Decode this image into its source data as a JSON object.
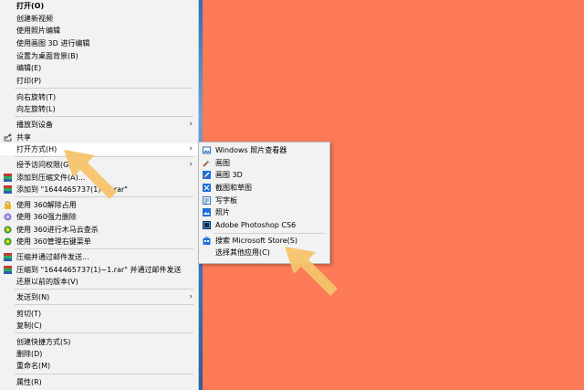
{
  "menu": {
    "items": [
      {
        "id": "open",
        "label": "打开(O)",
        "bold": true
      },
      {
        "id": "create-video",
        "label": "创建新视频"
      },
      {
        "id": "edit-with-photos",
        "label": "使用照片编辑"
      },
      {
        "id": "edit-paint3d",
        "label": "使用画图 3D 进行编辑"
      },
      {
        "id": "set-wallpaper",
        "label": "设置为桌面背景(B)"
      },
      {
        "id": "edit",
        "label": "编辑(E)"
      },
      {
        "id": "print",
        "label": "打印(P)"
      },
      {
        "id": "rotate-right",
        "label": "向右旋转(T)"
      },
      {
        "id": "rotate-left",
        "label": "向左旋转(L)"
      },
      {
        "id": "cast-to-device",
        "label": "播放到设备"
      },
      {
        "id": "share",
        "label": "共享"
      },
      {
        "id": "open-with",
        "label": "打开方式(H)"
      },
      {
        "id": "give-access",
        "label": "授予访问权限(G)"
      },
      {
        "id": "add-to-archive",
        "label": "添加到压缩文件(A)..."
      },
      {
        "id": "add-to-rar",
        "label": "添加到 \"1644465737(1)~1.rar\""
      },
      {
        "id": "360-unlock",
        "label": "使用 360解除占用"
      },
      {
        "id": "360-force-delete",
        "label": "使用 360强力删除"
      },
      {
        "id": "360-trojan-scan",
        "label": "使用 360进行木马云查杀"
      },
      {
        "id": "360-manage-menu",
        "label": "使用 360管理右键菜单"
      },
      {
        "id": "compress-email",
        "label": "压缩并通过邮件发送..."
      },
      {
        "id": "compress-rar-email",
        "label": "压缩到 \"1644465737(1)~1.rar\" 并通过邮件发送"
      },
      {
        "id": "restore-version",
        "label": "还原以前的版本(V)"
      },
      {
        "id": "send-to",
        "label": "发送到(N)"
      },
      {
        "id": "cut",
        "label": "剪切(T)"
      },
      {
        "id": "copy",
        "label": "复制(C)"
      },
      {
        "id": "create-shortcut",
        "label": "创建快捷方式(S)"
      },
      {
        "id": "delete",
        "label": "删除(D)"
      },
      {
        "id": "rename",
        "label": "重命名(M)"
      },
      {
        "id": "properties",
        "label": "属性(R)"
      }
    ]
  },
  "submenu": {
    "items": [
      {
        "id": "windows-photo-viewer",
        "label": "Windows 照片查看器"
      },
      {
        "id": "paint",
        "label": "画图"
      },
      {
        "id": "paint-3d",
        "label": "画图 3D"
      },
      {
        "id": "snip-sketch",
        "label": "截图和草图"
      },
      {
        "id": "wordpad",
        "label": "写字板"
      },
      {
        "id": "photos",
        "label": "照片"
      },
      {
        "id": "photoshop",
        "label": "Adobe Photoshop CS6"
      },
      {
        "id": "search-store",
        "label": "搜索 Microsoft Store(S)"
      },
      {
        "id": "choose-other-app",
        "label": "选择其他应用(C)"
      }
    ]
  },
  "colors": {
    "background": "#fd7a57",
    "menu_bg": "#f2f2f2",
    "arrow": "#f6c36c"
  },
  "icons": {
    "share": "share-icon",
    "archive": "winrar-icon",
    "tool360": "360-icon"
  }
}
